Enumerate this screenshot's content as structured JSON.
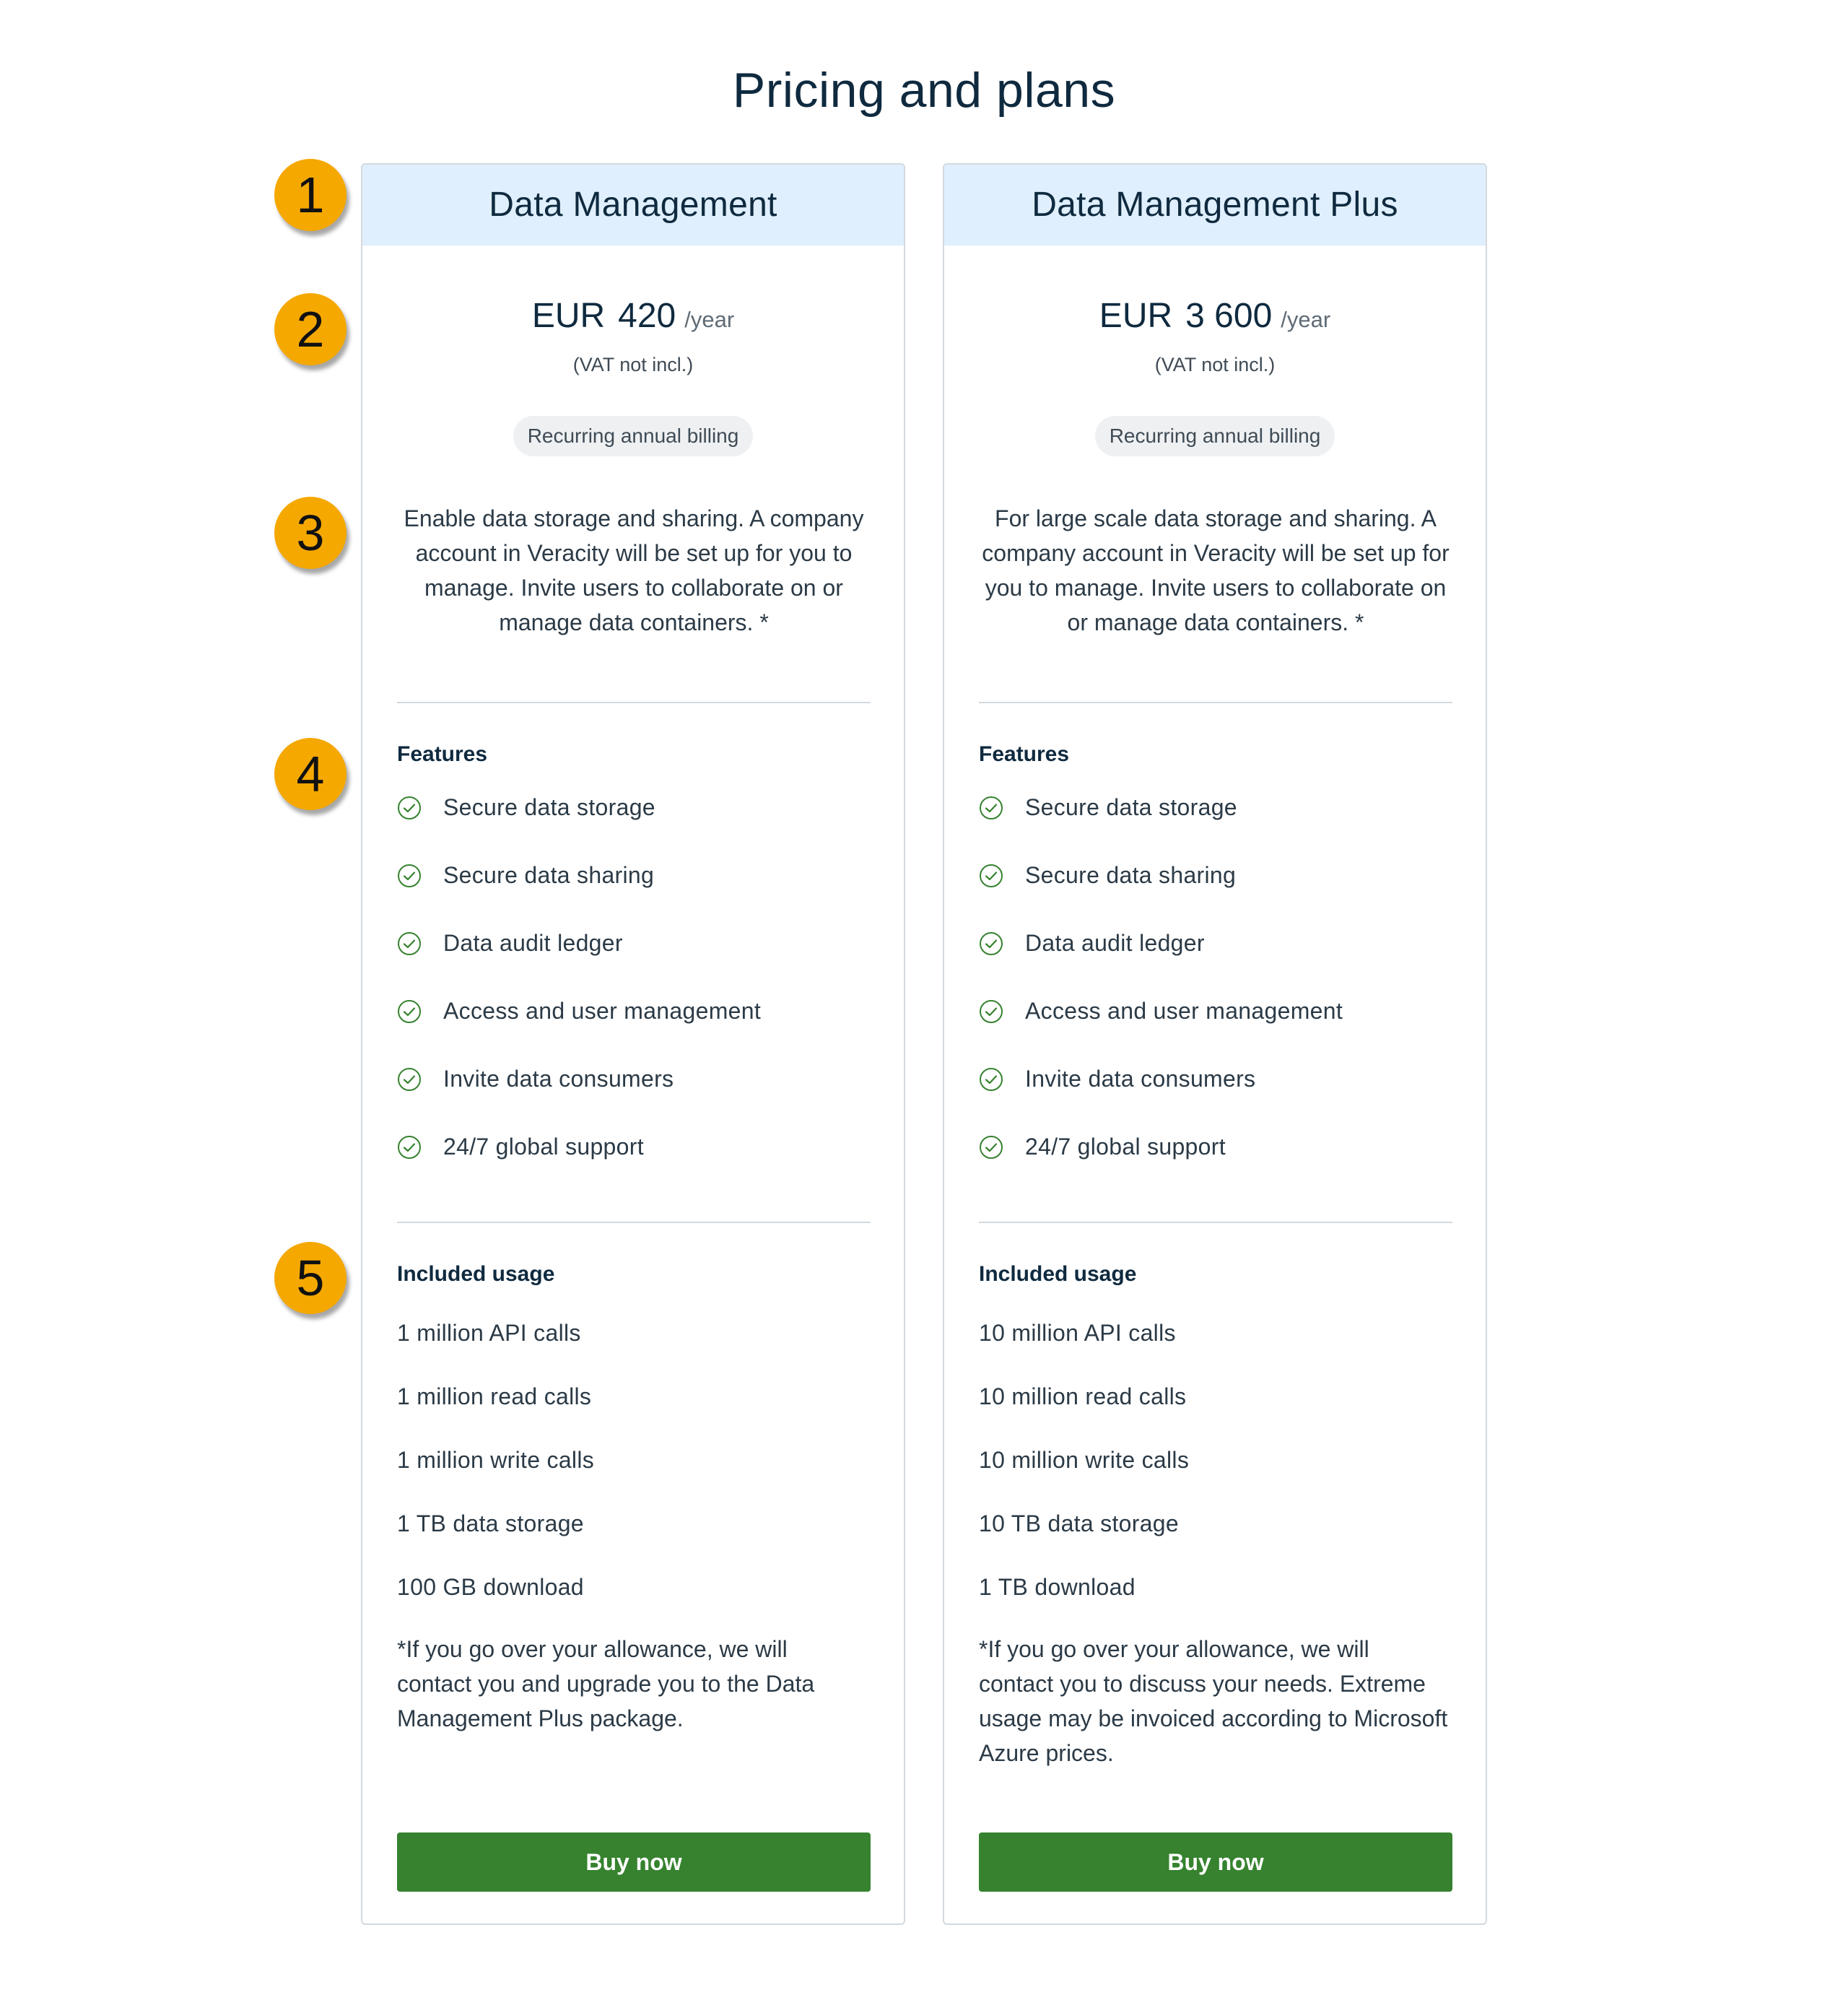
{
  "page": {
    "title": "Pricing and plans"
  },
  "steps": [
    "1",
    "2",
    "3",
    "4",
    "5"
  ],
  "colors": {
    "header_bg": "#dfeffd",
    "accent_green": "#36822f",
    "step_marker": "#f5a800",
    "text_dark": "#0f2a3f"
  },
  "plans": [
    {
      "name": "Data Management",
      "currency": "EUR",
      "price": "420",
      "period": "/year",
      "vat_note": "(VAT not incl.)",
      "billing": "Recurring annual billing",
      "description": "Enable data storage and sharing. A company account in Veracity will be set up for you to manage. Invite users to collaborate on or manage data containers. *",
      "features_title": "Features",
      "features": [
        "Secure data storage",
        "Secure data sharing",
        "Data audit ledger",
        "Access and user management",
        "Invite data consumers",
        "24/7 global support"
      ],
      "usage_title": "Included usage",
      "usage": [
        "1 million API calls",
        "1 million read calls",
        "1 million write calls",
        "1 TB data storage",
        "100 GB download"
      ],
      "footnote": "*If you go over your allowance, we will contact you and upgrade you to the Data Management Plus package.",
      "button_label": "Buy now"
    },
    {
      "name": "Data Management Plus",
      "currency": "EUR",
      "price": "3 600",
      "period": "/year",
      "vat_note": "(VAT not incl.)",
      "billing": "Recurring annual billing",
      "description": "For large scale data storage and sharing. A company account in Veracity will be set up for you to manage. Invite users to collaborate on or manage data containers. *",
      "features_title": "Features",
      "features": [
        "Secure data storage",
        "Secure data sharing",
        "Data audit ledger",
        "Access and user management",
        "Invite data consumers",
        "24/7 global support"
      ],
      "usage_title": "Included usage",
      "usage": [
        "10 million API calls",
        "10 million read calls",
        "10 million write calls",
        "10 TB data storage",
        "1 TB download"
      ],
      "footnote": "*If you go over your allowance, we will contact you to discuss your needs. Extreme usage may be invoiced according to Microsoft Azure prices.",
      "button_label": "Buy now"
    }
  ]
}
